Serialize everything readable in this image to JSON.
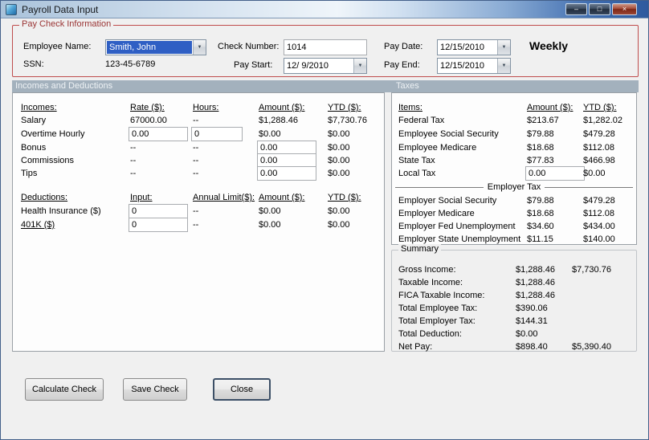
{
  "window": {
    "title": "Payroll Data Input",
    "controls": {
      "minimize": "–",
      "maximize": "□",
      "close": "×"
    }
  },
  "icons": {
    "dropdown": "▼"
  },
  "paycheck": {
    "group_label": "Pay Check Information",
    "employee_name_label": "Employee Name:",
    "employee_name": "Smith, John",
    "ssn_label": "SSN:",
    "ssn": "123-45-6789",
    "check_number_label": "Check Number:",
    "check_number": "1014",
    "pay_start_label": "Pay Start:",
    "pay_start": "12/ 9/2010",
    "pay_date_label": "Pay Date:",
    "pay_date": "12/15/2010",
    "pay_end_label": "Pay End:",
    "pay_end": "12/15/2010",
    "frequency": "Weekly"
  },
  "section_bar": {
    "left": "Incomes and Deductions",
    "right": "Taxes"
  },
  "incomes": {
    "headers": {
      "name": "Incomes:",
      "rate": "Rate ($):",
      "hours": "Hours:",
      "amount": "Amount ($):",
      "ytd": "YTD ($):"
    },
    "rows": [
      {
        "name": "Salary",
        "rate": "67000.00",
        "hours": "--",
        "amount": "$1,288.46",
        "ytd": "$7,730.76"
      },
      {
        "name": "Overtime Hourly",
        "rate": "0.00",
        "hours": "0",
        "amount": "$0.00",
        "ytd": "$0.00"
      },
      {
        "name": "Bonus",
        "rate": "--",
        "hours": "--",
        "amount": "0.00",
        "ytd": "$0.00"
      },
      {
        "name": "Commissions",
        "rate": "--",
        "hours": "--",
        "amount": "0.00",
        "ytd": "$0.00"
      },
      {
        "name": "Tips",
        "rate": "--",
        "hours": "--",
        "amount": "0.00",
        "ytd": "$0.00"
      }
    ]
  },
  "deductions": {
    "headers": {
      "name": "Deductions:",
      "input": "Input:",
      "limit": "Annual Limit($):",
      "amount": "Amount ($):",
      "ytd": "YTD ($):"
    },
    "rows": [
      {
        "name": "Health Insurance ($)",
        "input": "0",
        "limit": "--",
        "amount": "$0.00",
        "ytd": "$0.00"
      },
      {
        "name": "401K ($)",
        "input": "0",
        "limit": "--",
        "amount": "$0.00",
        "ytd": "$0.00"
      }
    ]
  },
  "taxes": {
    "headers": {
      "name": "Items:",
      "amount": "Amount ($):",
      "ytd": "YTD ($):"
    },
    "employee_rows": [
      {
        "name": "Federal Tax",
        "amount": "$213.67",
        "ytd": "$1,282.02"
      },
      {
        "name": "Employee Social Security",
        "amount": "$79.88",
        "ytd": "$479.28"
      },
      {
        "name": "Employee Medicare",
        "amount": "$18.68",
        "ytd": "$112.08"
      },
      {
        "name": "State Tax",
        "amount": "$77.83",
        "ytd": "$466.98"
      },
      {
        "name": "Local Tax",
        "amount": "0.00",
        "ytd": "$0.00"
      }
    ],
    "employer_separator": "Employer Tax",
    "employer_rows": [
      {
        "name": "Employer Social Security",
        "amount": "$79.88",
        "ytd": "$479.28"
      },
      {
        "name": "Employer Medicare",
        "amount": "$18.68",
        "ytd": "$112.08"
      },
      {
        "name": "Employer Fed Unemployment",
        "amount": "$34.60",
        "ytd": "$434.00"
      },
      {
        "name": "Employer State Unemployment",
        "amount": "$11.15",
        "ytd": "$140.00"
      }
    ]
  },
  "summary": {
    "group_label": "Summary",
    "rows": [
      {
        "name": "Gross Income:",
        "amount": "$1,288.46",
        "ytd": "$7,730.76"
      },
      {
        "name": "Taxable Income:",
        "amount": "$1,288.46",
        "ytd": ""
      },
      {
        "name": "FICA Taxable Income:",
        "amount": "$1,288.46",
        "ytd": ""
      },
      {
        "name": "Total Employee Tax:",
        "amount": "$390.06",
        "ytd": ""
      },
      {
        "name": "Total Employer Tax:",
        "amount": "$144.31",
        "ytd": ""
      },
      {
        "name": "Total Deduction:",
        "amount": "$0.00",
        "ytd": ""
      },
      {
        "name": "Net Pay:",
        "amount": "$898.40",
        "ytd": "$5,390.40"
      }
    ]
  },
  "buttons": {
    "calculate": "Calculate Check",
    "save": "Save Check",
    "close": "Close"
  },
  "colors": {
    "group_border": "#bf4d4d",
    "section_bar": "#a3b1bd",
    "selection_blue": "#2f5fc4"
  }
}
